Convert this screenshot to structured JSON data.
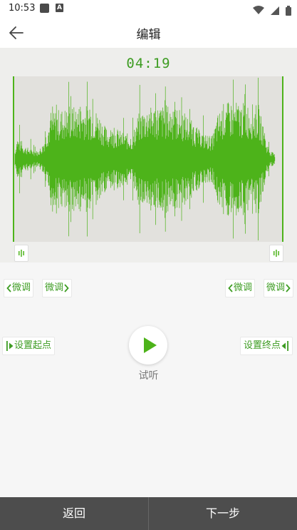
{
  "status_bar": {
    "time": "10:53",
    "notification_icon_letter": "A"
  },
  "header": {
    "title": "编辑"
  },
  "recording": {
    "duration": "04:19"
  },
  "fine_tune": {
    "start_left_label": "微调",
    "start_right_label": "微调",
    "end_left_label": "微调",
    "end_right_label": "微调"
  },
  "controls": {
    "set_start_label": "设置起点",
    "set_end_label": "设置终点",
    "preview_label": "试听"
  },
  "footer": {
    "back_label": "返回",
    "next_label": "下一步"
  },
  "colors": {
    "accent": "#4db31a",
    "wave_bg": "#e2e1dd",
    "bottom_bar": "#4d4d4d"
  },
  "icons": {
    "back": "arrow-left-icon",
    "play": "play-icon",
    "wifi": "wifi-icon",
    "signal": "signal-icon",
    "battery": "battery-icon"
  }
}
